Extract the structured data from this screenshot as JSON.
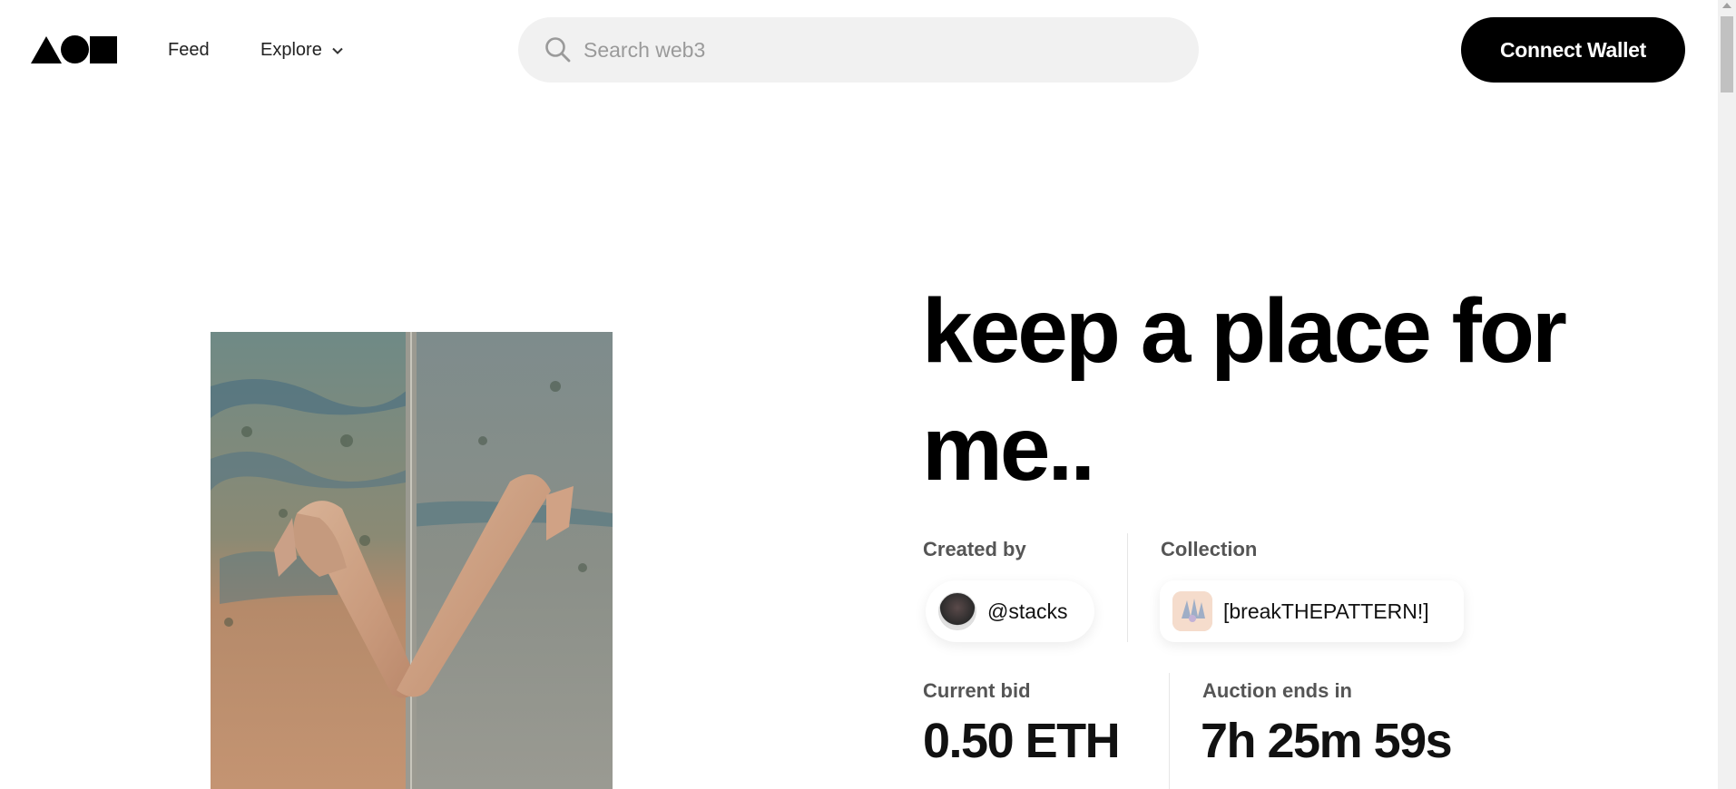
{
  "header": {
    "nav": {
      "feed_label": "Feed",
      "explore_label": "Explore"
    },
    "search": {
      "placeholder": "Search web3",
      "value": ""
    },
    "connect_label": "Connect Wallet"
  },
  "artwork": {
    "title": "keep a place for me.."
  },
  "meta": {
    "created_label": "Created by",
    "creator_handle": "@stacks",
    "collection_label": "Collection",
    "collection_name": "[breakTHEPATTERN!]"
  },
  "auction": {
    "bid_label": "Current bid",
    "bid_value": "0.50 ETH",
    "ends_label": "Auction ends in",
    "ends_value": "7h 25m 59s"
  },
  "icons": {
    "logo": "triangle-circle-square-logo",
    "search": "search-icon",
    "chevron": "chevron-down-icon"
  }
}
